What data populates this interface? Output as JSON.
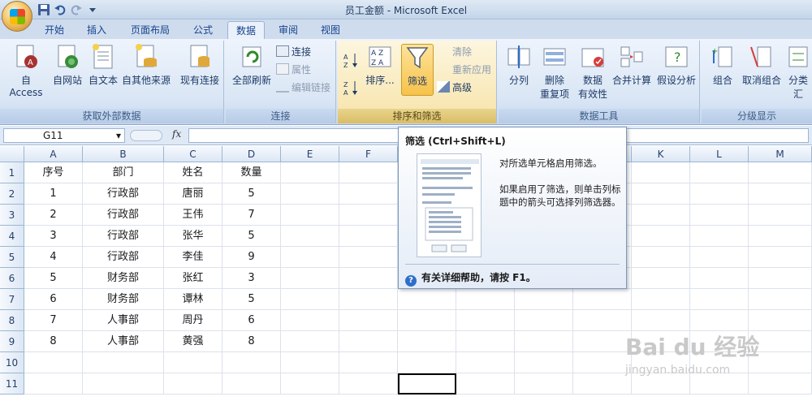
{
  "window": {
    "title": "员工金额 - Microsoft Excel"
  },
  "tabs": [
    {
      "label": "开始"
    },
    {
      "label": "插入"
    },
    {
      "label": "页面布局"
    },
    {
      "label": "公式"
    },
    {
      "label": "数据",
      "active": true
    },
    {
      "label": "审阅"
    },
    {
      "label": "视图"
    }
  ],
  "ribbon": {
    "get_external": {
      "label": "获取外部数据",
      "buttons": [
        "自 Access",
        "自网站",
        "自文本",
        "自其他来源",
        "现有连接"
      ]
    },
    "connections": {
      "label": "连接",
      "refresh_all": "全部刷新",
      "connections": "连接",
      "properties": "属性",
      "edit_links": "编辑链接"
    },
    "sort_filter": {
      "label": "排序和筛选",
      "sort": "排序...",
      "filter": "筛选",
      "clear": "清除",
      "reapply": "重新应用",
      "advanced": "高级"
    },
    "data_tools": {
      "label": "数据工具",
      "text_to_columns": "分列",
      "remove_dup_1": "删除",
      "remove_dup_2": "重复项",
      "validation_1": "数据",
      "validation_2": "有效性",
      "consolidate": "合并计算",
      "what_if": "假设分析"
    },
    "outline": {
      "label": "分级显示",
      "group": "组合",
      "ungroup": "取消组合",
      "subtotal": "分类汇"
    }
  },
  "formula_bar": {
    "name_box": "G11",
    "fx": "fx",
    "value": ""
  },
  "sheet": {
    "columns": [
      "A",
      "B",
      "C",
      "D",
      "E",
      "F",
      "G",
      "H",
      "I",
      "J",
      "K",
      "L",
      "M"
    ],
    "rows": [
      [
        "序号",
        "部门",
        "姓名",
        "数量"
      ],
      [
        "1",
        "行政部",
        "唐丽",
        "5"
      ],
      [
        "2",
        "行政部",
        "王伟",
        "7"
      ],
      [
        "3",
        "行政部",
        "张华",
        "5"
      ],
      [
        "4",
        "行政部",
        "李佳",
        "9"
      ],
      [
        "5",
        "财务部",
        "张红",
        "3"
      ],
      [
        "6",
        "财务部",
        "谭林",
        "5"
      ],
      [
        "7",
        "人事部",
        "周丹",
        "6"
      ],
      [
        "8",
        "人事部",
        "黄强",
        "8"
      ],
      [
        "",
        "",
        "",
        ""
      ],
      [
        "",
        "",
        "",
        ""
      ]
    ],
    "row_numbers": [
      "1",
      "2",
      "3",
      "4",
      "5",
      "6",
      "7",
      "8",
      "9",
      "10",
      "11"
    ],
    "selected_cell": "G11"
  },
  "tooltip": {
    "title": "筛选 (Ctrl+Shift+L)",
    "desc1": "对所选单元格启用筛选。",
    "desc2": "如果启用了筛选，则单击列标题中的箭头可选择列筛选器。",
    "help": "有关详细帮助，请按 F1。"
  },
  "watermark": {
    "brand": "Bai du 经验",
    "url": "jingyan.baidu.com"
  }
}
